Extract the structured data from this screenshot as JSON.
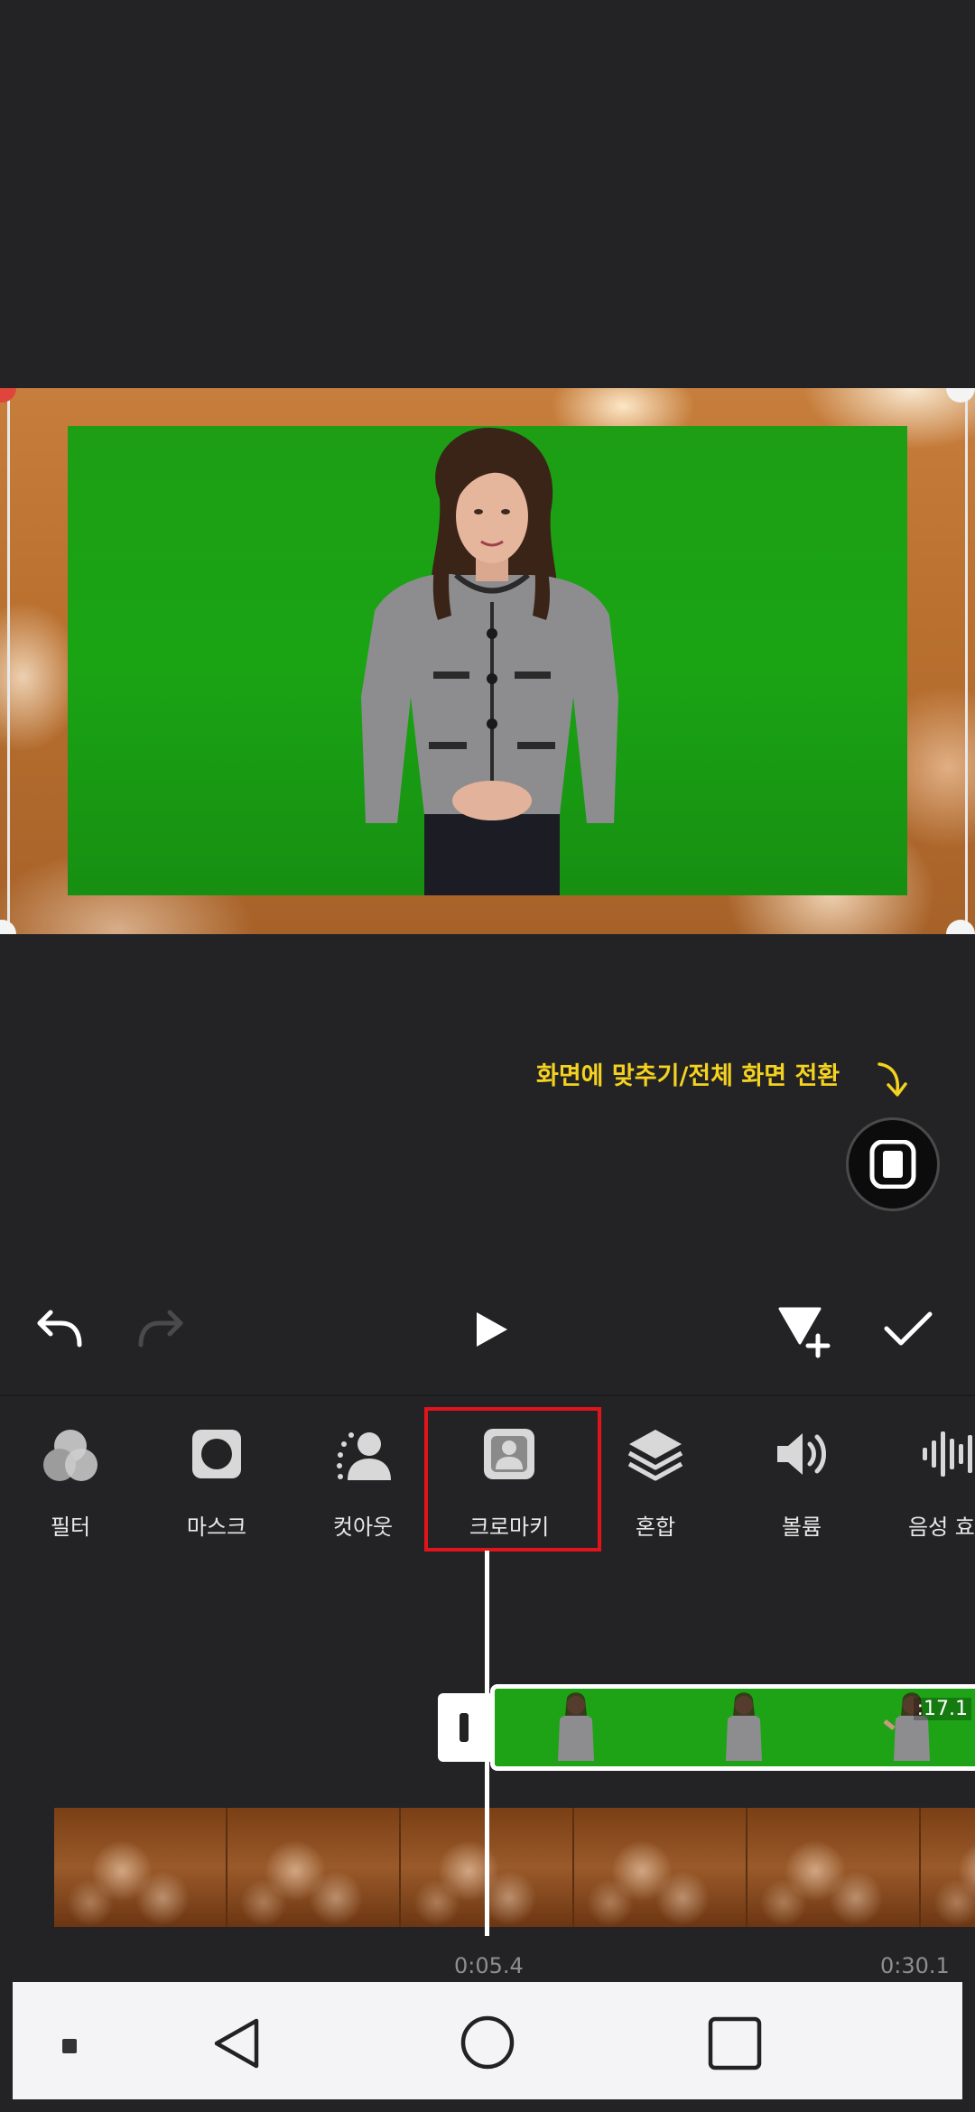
{
  "preview": {
    "hint_text": "화면에 맞추기/전체 화면 전환",
    "hint_arrow_icon": "curved-arrow-down-icon",
    "fit_button_icon": "fit-screen-icon"
  },
  "controls": {
    "undo_icon": "undo-icon",
    "redo_icon": "redo-icon",
    "play_icon": "play-icon",
    "add_keyframe_icon": "add-keyframe-icon",
    "confirm_icon": "checkmark-icon"
  },
  "tools": [
    {
      "label": "필터",
      "icon": "filter-icon"
    },
    {
      "label": "마스크",
      "icon": "mask-icon"
    },
    {
      "label": "컷아웃",
      "icon": "cutout-icon"
    },
    {
      "label": "크로마키",
      "icon": "chroma-key-icon",
      "highlighted": true
    },
    {
      "label": "혼합",
      "icon": "blend-icon"
    },
    {
      "label": "볼륨",
      "icon": "volume-icon"
    },
    {
      "label": "음성 효",
      "icon": "voice-effect-icon"
    }
  ],
  "timeline": {
    "clip_duration": ":17.1",
    "current_time": "0:05.4",
    "total_time": "0:30.1"
  },
  "navbar": {
    "recent_small_icon": "square-small-icon",
    "back_icon": "back-triangle-icon",
    "home_icon": "home-circle-icon",
    "recents_icon": "recents-square-icon"
  },
  "colors": {
    "accent_highlight": "#e2141b",
    "hint_yellow": "#f4d21f",
    "background": "#232325",
    "green_screen": "#1aa414"
  }
}
